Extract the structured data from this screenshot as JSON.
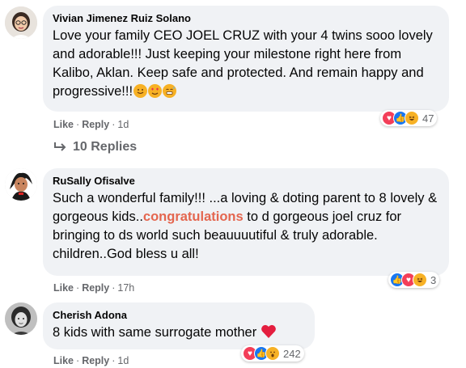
{
  "comments": [
    {
      "author": "Vivian Jimenez Ruiz Solano",
      "text": "Love your family CEO JOEL CRUZ with your 4 twins sooo lovely and adorable!!! Just keeping your milestone right here from Kalibo, Aklan. Keep safe and protected. And remain happy and progressive!!!",
      "like": "Like",
      "reply": "Reply",
      "time": "1d",
      "reaction_count": "47",
      "reactions": [
        "love-icon",
        "like-icon",
        "haha-icon"
      ],
      "emoji": [
        "smile-emoji",
        "heart-eyes-emoji",
        "grin-sweat-emoji"
      ]
    },
    {
      "author": "RuSally Ofisalve",
      "text_parts": [
        "Such a wonderful family!!! ...a loving & doting parent to 8 lovely & gorgeous kids..",
        "congratulations",
        " to d gorgeous joel cruz for bringing to ds world such beauuuutiful & truly adorable. children..God bless u all!"
      ],
      "like": "Like",
      "reply": "Reply",
      "time": "17h",
      "reaction_count": "3",
      "reactions": [
        "like-icon",
        "love-icon",
        "haha-icon"
      ]
    },
    {
      "author": "Cherish Adona",
      "text": "8 kids with same surrogate mother",
      "like": "Like",
      "reply": "Reply",
      "time": "1d",
      "reaction_count": "242",
      "reactions": [
        "love-icon",
        "like-icon",
        "wow-icon"
      ],
      "emoji": [
        "red-heart-emoji"
      ]
    }
  ],
  "replies_link": "10 Replies",
  "colors": {
    "bubble": "#f0f2f5",
    "highlight": "#e4664f",
    "meta": "#65676b"
  }
}
